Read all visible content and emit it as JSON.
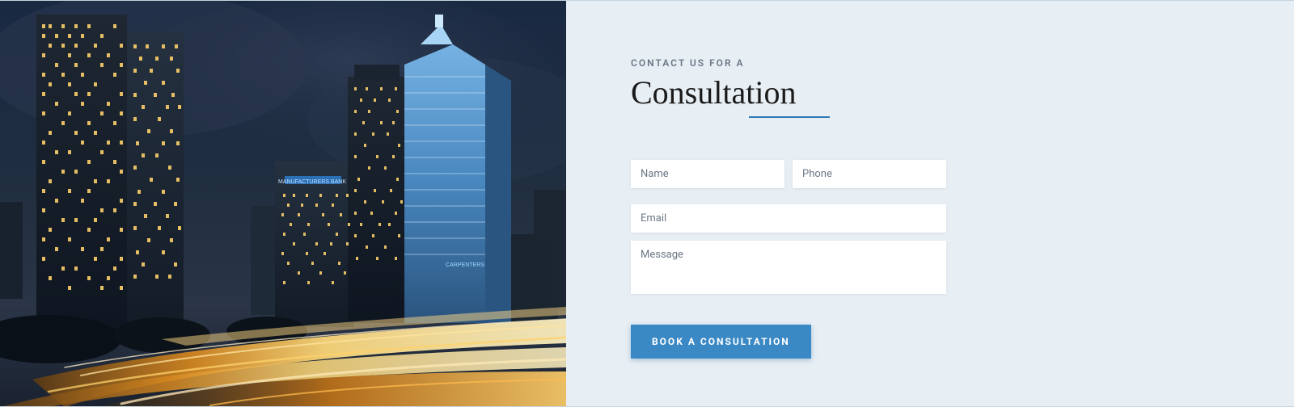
{
  "header": {
    "eyebrow": "CONTACT US FOR A",
    "heading": "Consultation"
  },
  "form": {
    "name_placeholder": "Name",
    "phone_placeholder": "Phone",
    "email_placeholder": "Email",
    "message_placeholder": "Message",
    "submit_label": "BOOK A CONSULTATION"
  }
}
